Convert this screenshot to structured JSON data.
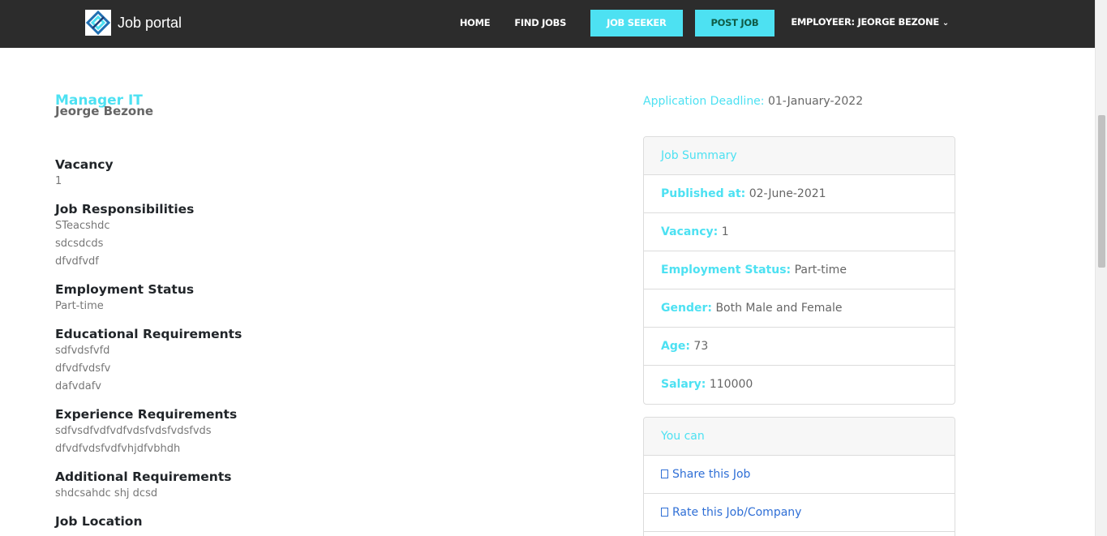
{
  "brand": {
    "name": "Job portal"
  },
  "nav": {
    "home": "HOME",
    "find_jobs": "FIND JOBS",
    "job_seeker": "JOB SEEKER",
    "post_job": "POST JOB",
    "employer": "EMPLOYEER: JEORGE BEZONE"
  },
  "job": {
    "title": "Manager IT",
    "company": "Jeorge Bezone"
  },
  "sections": {
    "vacancy": {
      "heading": "Vacancy",
      "lines": [
        "1"
      ]
    },
    "responsibilities": {
      "heading": "Job Responsibilities",
      "lines": [
        "STeacshdc",
        "sdcsdcds",
        "dfvdfvdf"
      ]
    },
    "employment_status": {
      "heading": "Employment Status",
      "lines": [
        "Part-time"
      ]
    },
    "education": {
      "heading": "Educational Requirements",
      "lines": [
        "sdfvdsfvfd",
        "dfvdfvdsfv",
        "dafvdafv"
      ]
    },
    "experience": {
      "heading": "Experience Requirements",
      "lines": [
        "sdfvsdfvdfvdfvdsfvdsfvdsfvds",
        "dfvdfvdsfvdfvhjdfvbhdh"
      ]
    },
    "additional": {
      "heading": "Additional Requirements",
      "lines": [
        "shdcsahdc shj dcsd"
      ]
    },
    "location": {
      "heading": "Job Location"
    }
  },
  "deadline": {
    "label": "Application Deadline:",
    "value": "01-January-2022"
  },
  "summary": {
    "heading": "Job Summary",
    "published_label": "Published at:",
    "published_value": "02-June-2021",
    "vacancy_label": "Vacancy:",
    "vacancy_value": "1",
    "status_label": "Employment Status:",
    "status_value": "Part-time",
    "gender_label": "Gender:",
    "gender_value": "Both Male and Female",
    "age_label": "Age:",
    "age_value": "73",
    "salary_label": "Salary:",
    "salary_value": "110000"
  },
  "actions": {
    "heading": "You can",
    "share": "Share this Job",
    "rate": "Rate this Job/Company"
  },
  "colors": {
    "accent": "#4de1f2",
    "navbar": "#2c2c2c",
    "link": "#2f6fd6"
  }
}
